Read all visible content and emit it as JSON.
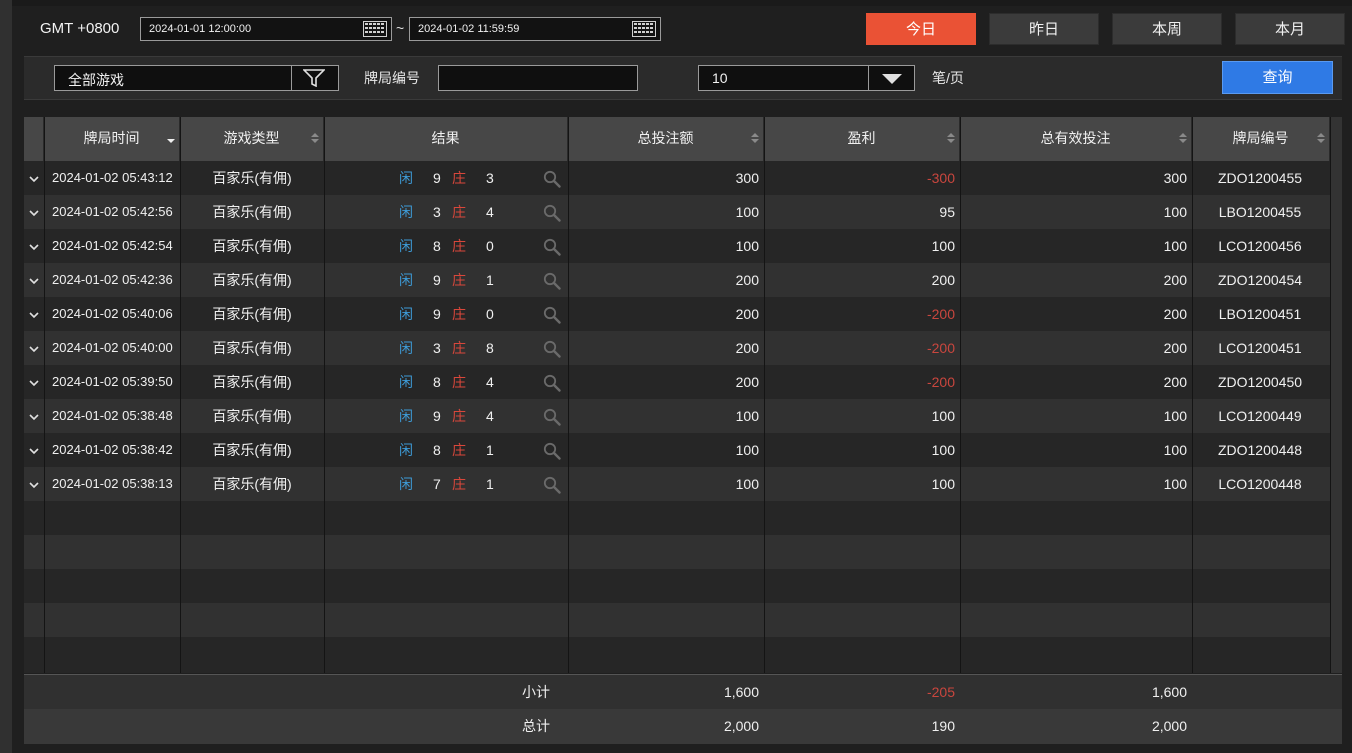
{
  "header": {
    "timezone": "GMT +0800",
    "start": "2024-01-01 12:00:00",
    "separator": "~",
    "end": "2024-01-02 11:59:59",
    "quick_ranges": [
      "今日",
      "昨日",
      "本周",
      "本月"
    ],
    "active_range": "今日"
  },
  "filters": {
    "game": "全部游戏",
    "round_label": "牌局编号",
    "round_value": "",
    "page_size": "10",
    "per_page_label": "笔/页",
    "query_label": "查询"
  },
  "table": {
    "columns": [
      "牌局时间",
      "游戏类型",
      "结果",
      "总投注额",
      "盈利",
      "总有效投注",
      "牌局编号"
    ],
    "player_label": "闲",
    "banker_label": "庄",
    "rows": [
      {
        "time": "2024-01-02 05:43:12",
        "game": "百家乐(有佣)",
        "player": "9",
        "banker": "3",
        "bet": "300",
        "win": "-300",
        "valid": "300",
        "id": "ZDO1200455"
      },
      {
        "time": "2024-01-02 05:42:56",
        "game": "百家乐(有佣)",
        "player": "3",
        "banker": "4",
        "bet": "100",
        "win": "95",
        "valid": "100",
        "id": "LBO1200455"
      },
      {
        "time": "2024-01-02 05:42:54",
        "game": "百家乐(有佣)",
        "player": "8",
        "banker": "0",
        "bet": "100",
        "win": "100",
        "valid": "100",
        "id": "LCO1200456"
      },
      {
        "time": "2024-01-02 05:42:36",
        "game": "百家乐(有佣)",
        "player": "9",
        "banker": "1",
        "bet": "200",
        "win": "200",
        "valid": "200",
        "id": "ZDO1200454"
      },
      {
        "time": "2024-01-02 05:40:06",
        "game": "百家乐(有佣)",
        "player": "9",
        "banker": "0",
        "bet": "200",
        "win": "-200",
        "valid": "200",
        "id": "LBO1200451"
      },
      {
        "time": "2024-01-02 05:40:00",
        "game": "百家乐(有佣)",
        "player": "3",
        "banker": "8",
        "bet": "200",
        "win": "-200",
        "valid": "200",
        "id": "LCO1200451"
      },
      {
        "time": "2024-01-02 05:39:50",
        "game": "百家乐(有佣)",
        "player": "8",
        "banker": "4",
        "bet": "200",
        "win": "-200",
        "valid": "200",
        "id": "ZDO1200450"
      },
      {
        "time": "2024-01-02 05:38:48",
        "game": "百家乐(有佣)",
        "player": "9",
        "banker": "4",
        "bet": "100",
        "win": "100",
        "valid": "100",
        "id": "LCO1200449"
      },
      {
        "time": "2024-01-02 05:38:42",
        "game": "百家乐(有佣)",
        "player": "8",
        "banker": "1",
        "bet": "100",
        "win": "100",
        "valid": "100",
        "id": "ZDO1200448"
      },
      {
        "time": "2024-01-02 05:38:13",
        "game": "百家乐(有佣)",
        "player": "7",
        "banker": "1",
        "bet": "100",
        "win": "100",
        "valid": "100",
        "id": "LCO1200448"
      }
    ]
  },
  "footer": {
    "subtotal": {
      "label": "小计",
      "bet": "1,600",
      "win": "-205",
      "valid": "1,600"
    },
    "total": {
      "label": "总计",
      "bet": "2,000",
      "win": "190",
      "valid": "2,000"
    }
  },
  "colors": {
    "active": "#ea5235",
    "query": "#2f7ae5",
    "negative": "#c9463e",
    "player": "#3d9ad6",
    "banker": "#d9473b"
  },
  "icons": [
    "calendar-icon",
    "filter-icon",
    "caret-down-icon",
    "sort-icon",
    "expand-chevron-icon",
    "magnifier-icon"
  ]
}
